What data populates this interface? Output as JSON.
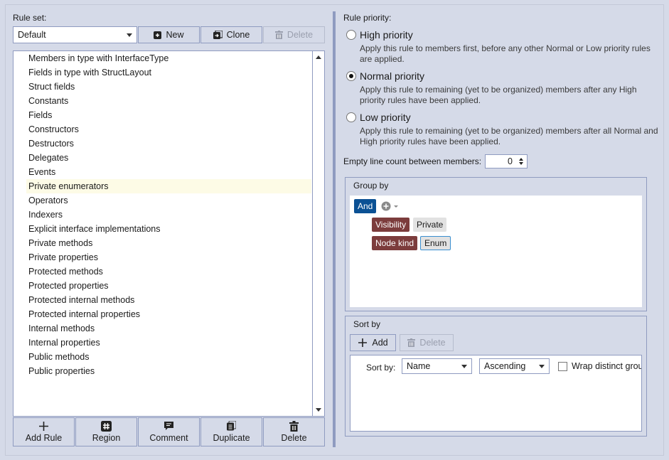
{
  "rule_set": {
    "label": "Rule set:",
    "selected": "Default",
    "new_label": "New",
    "clone_label": "Clone",
    "delete_label": "Delete"
  },
  "rules": [
    {
      "label": "Members in type with InterfaceType"
    },
    {
      "label": "Fields in type with StructLayout"
    },
    {
      "label": "Struct fields"
    },
    {
      "label": "Constants"
    },
    {
      "label": "Fields"
    },
    {
      "label": "Constructors"
    },
    {
      "label": "Destructors"
    },
    {
      "label": "Delegates"
    },
    {
      "label": "Events"
    },
    {
      "label": "Private enumerators",
      "selected": true
    },
    {
      "label": "Operators"
    },
    {
      "label": "Indexers"
    },
    {
      "label": "Explicit interface implementations"
    },
    {
      "label": "Private methods"
    },
    {
      "label": "Private properties"
    },
    {
      "label": "Protected methods"
    },
    {
      "label": "Protected properties"
    },
    {
      "label": "Protected internal methods"
    },
    {
      "label": "Protected internal properties"
    },
    {
      "label": "Internal methods"
    },
    {
      "label": "Internal properties"
    },
    {
      "label": "Public methods"
    },
    {
      "label": "Public properties"
    }
  ],
  "bottom_buttons": {
    "add_rule": "Add Rule",
    "region": "Region",
    "comment": "Comment",
    "duplicate": "Duplicate",
    "delete": "Delete"
  },
  "priority": {
    "label": "Rule priority:",
    "options": [
      {
        "title": "High priority",
        "desc": "Apply this rule to members first, before any other Normal or Low priority rules are applied.",
        "checked": false
      },
      {
        "title": "Normal priority",
        "desc": "Apply this rule to remaining (yet to be organized) members after any High priority rules have been applied.",
        "checked": true
      },
      {
        "title": "Low priority",
        "desc": "Apply this rule to remaining (yet to be organized) members after all Normal and High priority rules have been applied.",
        "checked": false
      }
    ]
  },
  "empty_lines": {
    "label": "Empty line count between members:",
    "value": "0"
  },
  "group_by": {
    "title": "Group by",
    "operator": "And",
    "conditions": [
      {
        "key": "Visibility",
        "value": "Private"
      },
      {
        "key": "Node kind",
        "value": "Enum"
      }
    ]
  },
  "sort_by": {
    "title": "Sort by",
    "add_label": "Add",
    "delete_label": "Delete",
    "row_label": "Sort by:",
    "field": "Name",
    "direction": "Ascending",
    "wrap_label": "Wrap distinct grou",
    "wrap_checked": false
  },
  "colors": {
    "background": "#d5dae8",
    "border": "#8f9bc0",
    "operator_tag": "#0b5194",
    "key_tag": "#7c3c3c",
    "selection_highlight": "#fdfbe6"
  }
}
